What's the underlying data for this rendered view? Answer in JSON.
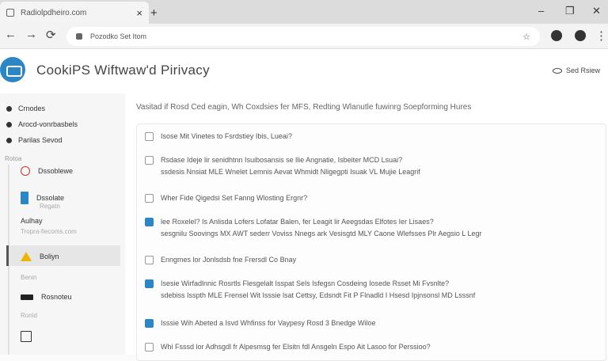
{
  "browser": {
    "tab_title": "Radiolpdheiro.com",
    "tab_close": "×",
    "new_tab": "+",
    "window_controls": [
      "–",
      "❐",
      "✕"
    ],
    "url": "Pozodko Set Itom",
    "nav": [
      "←",
      "→",
      "⟳"
    ]
  },
  "header": {
    "title": "CookiPS Wiftwaw'd Pirivacy",
    "link_label": "Sed Rsiew"
  },
  "sidebar": {
    "top_items": [
      "Crnodes",
      "Arocd-vonrbasbels",
      "Parilas Sevod"
    ],
    "section_label": "Rotoa",
    "sub_items": [
      {
        "icon": "clock-icon",
        "label": "Dssoblewe",
        "sub": ""
      },
      {
        "icon": "bookmark-icon",
        "label": "Dssolate",
        "sub": "Regatn"
      },
      {
        "icon": "",
        "label": "Aulhay",
        "sub": "Tropra-fiecoms.com"
      },
      {
        "icon": "warning-icon",
        "label": "Boliyn",
        "sub": ""
      },
      {
        "icon": "",
        "label": "",
        "sub": "Benin"
      },
      {
        "icon": "keyboard-icon",
        "label": "Rosnoteu",
        "sub": ""
      },
      {
        "icon": "",
        "label": "",
        "sub": "Ronid"
      },
      {
        "icon": "calendar-icon",
        "label": "",
        "sub": ""
      }
    ]
  },
  "main": {
    "intro": "Vasitad if Rosd Ced eagin, Wh Coxdsies fer MFS, Redting Wlanutle fuwinrg Soepforming Hures",
    "options": [
      {
        "checked": false,
        "lines": [
          "Isose Mit Vinetes to Fsrdstiey Ibis, Lueai?"
        ]
      },
      {
        "checked": false,
        "lines": [
          "Rsdase Ideje lir senidhtnn Isuibosansis se llie Angnatie, Isbeiter MCD Lsuai?",
          "ssdesis Nnsiat MLE Wnelet Lemnis Aevat Whmidt Nligegpti Isuak VL Mujie Leagrif"
        ]
      },
      {
        "checked": false,
        "lines": [
          "Wher Fide Qigedsi Set Fanng Wlosting Ergnr?"
        ]
      },
      {
        "checked": true,
        "lines": [
          "lee Roxelel? Is Anlisda Lofers Lofatar Balen, fer Leagit lir Aeegsdas Elfotes Ier Lisaes?",
          "sesgnilu Soovings MX AWT sederr Voviss Nnegs ark Vesisgtd MLY Caone Wlefsses Plr Aegsio L Legr"
        ]
      },
      {
        "checked": false,
        "lines": [
          "Enngmes lor Jonlsdsb fne Frersdl Co Bnay"
        ]
      },
      {
        "checked": true,
        "lines": [
          "Isesie Wirfadlnnic Rosrtls Flesgelalt Isspat Sels Isfegsn Cosdeing Iosede Rsset Mi Fvsnlte?",
          "sdebiss Isspth MLE Frensel Wit Isssie lsat Cettsy, Edsndt Fit P Flnadld I Hsesd Ipjnsonsl MD Lsssnf"
        ]
      },
      {
        "checked": true,
        "lines": [
          "Isssie Wih Abeted a Isvd Whfinss for Vaypesy Rosd 3 Bnedge Wiloe"
        ]
      },
      {
        "checked": false,
        "lines": [
          "Whi Fsssd lor Adhsgdl fr Alpesmsg fer Elsitn fdl Ansgeln Espo Ait Lasoo for Perssioo?"
        ]
      }
    ]
  },
  "colors": {
    "accent": "#2b86c6",
    "warning": "#f0b400"
  }
}
